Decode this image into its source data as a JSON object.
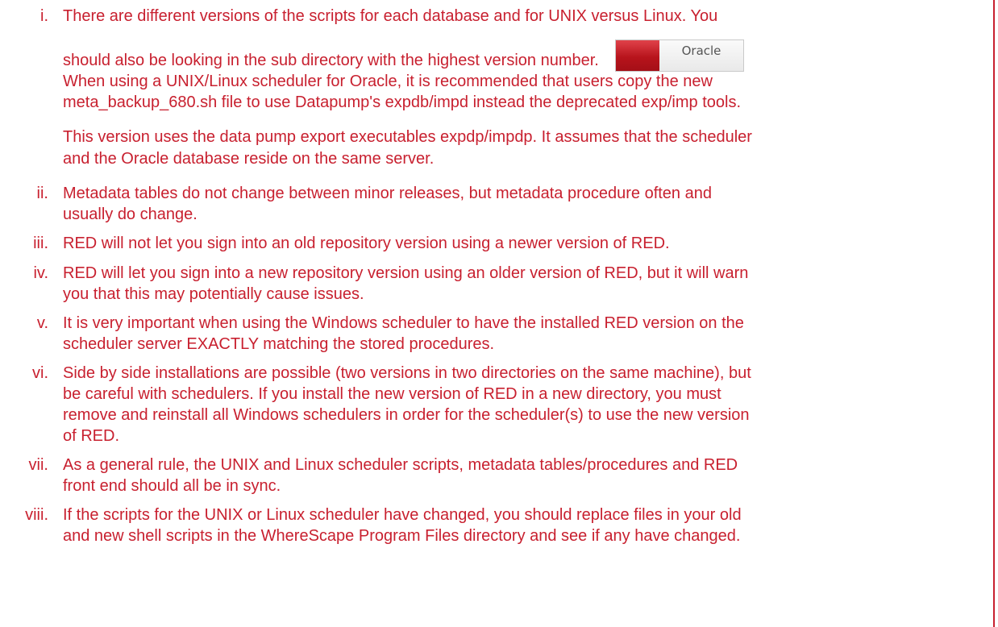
{
  "items": [
    {
      "marker": "i.",
      "lines": [
        "There are different versions of the scripts for each database and for UNIX versus Linux. You",
        "should also be looking in the sub directory with the highest version number.",
        "When using a UNIX/Linux scheduler for Oracle, it is recommended that users copy the new",
        "meta_backup_680.sh file to use Datapump's expdb/impd instead the deprecated exp/imp tools.",
        "This version uses the data pump export executables expdp/impdp. It assumes that the scheduler",
        "and the Oracle database reside on the same server."
      ]
    },
    {
      "marker": "ii.",
      "lines": [
        "Metadata tables do not change between minor releases, but metadata procedure often and",
        "usually do change."
      ]
    },
    {
      "marker": "iii.",
      "lines": [
        "RED will not let you sign into an old repository version using a newer version of RED."
      ]
    },
    {
      "marker": "iv.",
      "lines": [
        "RED will let you sign into a new repository version using an older version of RED, but it will warn",
        "you that this may potentially cause issues."
      ]
    },
    {
      "marker": "v.",
      "lines": [
        "It is very important when using the Windows scheduler to have the installed RED version on the",
        "scheduler server EXACTLY matching the stored procedures."
      ]
    },
    {
      "marker": "vi.",
      "lines": [
        " Side by side installations are possible (two versions in two directories on the same machine), but",
        "be careful with schedulers. If you install the new version of RED in a new directory, you must",
        "remove and reinstall all Windows schedulers in order for the scheduler(s) to use the new version",
        "of RED."
      ]
    },
    {
      "marker": "vii.",
      "lines": [
        "As a general rule, the UNIX and Linux scheduler scripts, metadata tables/procedures and RED",
        "front end should all be in sync."
      ]
    },
    {
      "marker": "viii.",
      "lines": [
        "If the scripts for the UNIX or Linux scheduler have changed, you should replace files in your old",
        "and new shell scripts in the WhereScape Program Files directory and see if any have changed."
      ]
    }
  ],
  "oracle_tab": {
    "label": "Oracle"
  },
  "colors": {
    "text": "#c8202f",
    "border": "#c8202f",
    "tab_swatch": "#b8141c"
  }
}
